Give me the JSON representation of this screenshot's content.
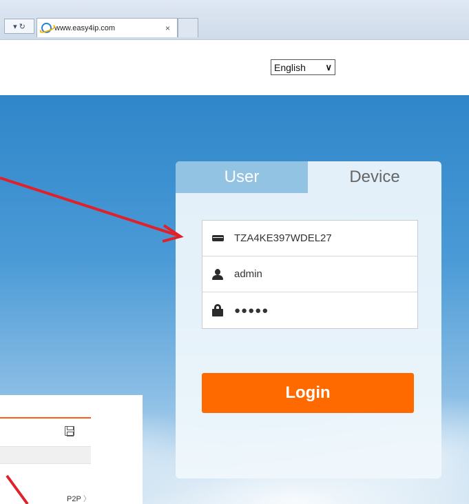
{
  "browser": {
    "nav_symbols": "▾ ↻",
    "tab_title": "www.easy4ip.com",
    "tab_close": "×"
  },
  "language": {
    "selected": "English",
    "chevron": "∨"
  },
  "login": {
    "tab_user": "User",
    "tab_device": "Device",
    "device_id": "TZA4KE397WDEL27",
    "username": "admin",
    "password_mask": "●●●●●",
    "button": "Login"
  },
  "overlay": {
    "p2p_label": "P2P",
    "p2p_chevron": "〉"
  },
  "colors": {
    "accent": "#ff6a00",
    "arrow": "#e0202a",
    "tab_active": "#93c3e3"
  }
}
